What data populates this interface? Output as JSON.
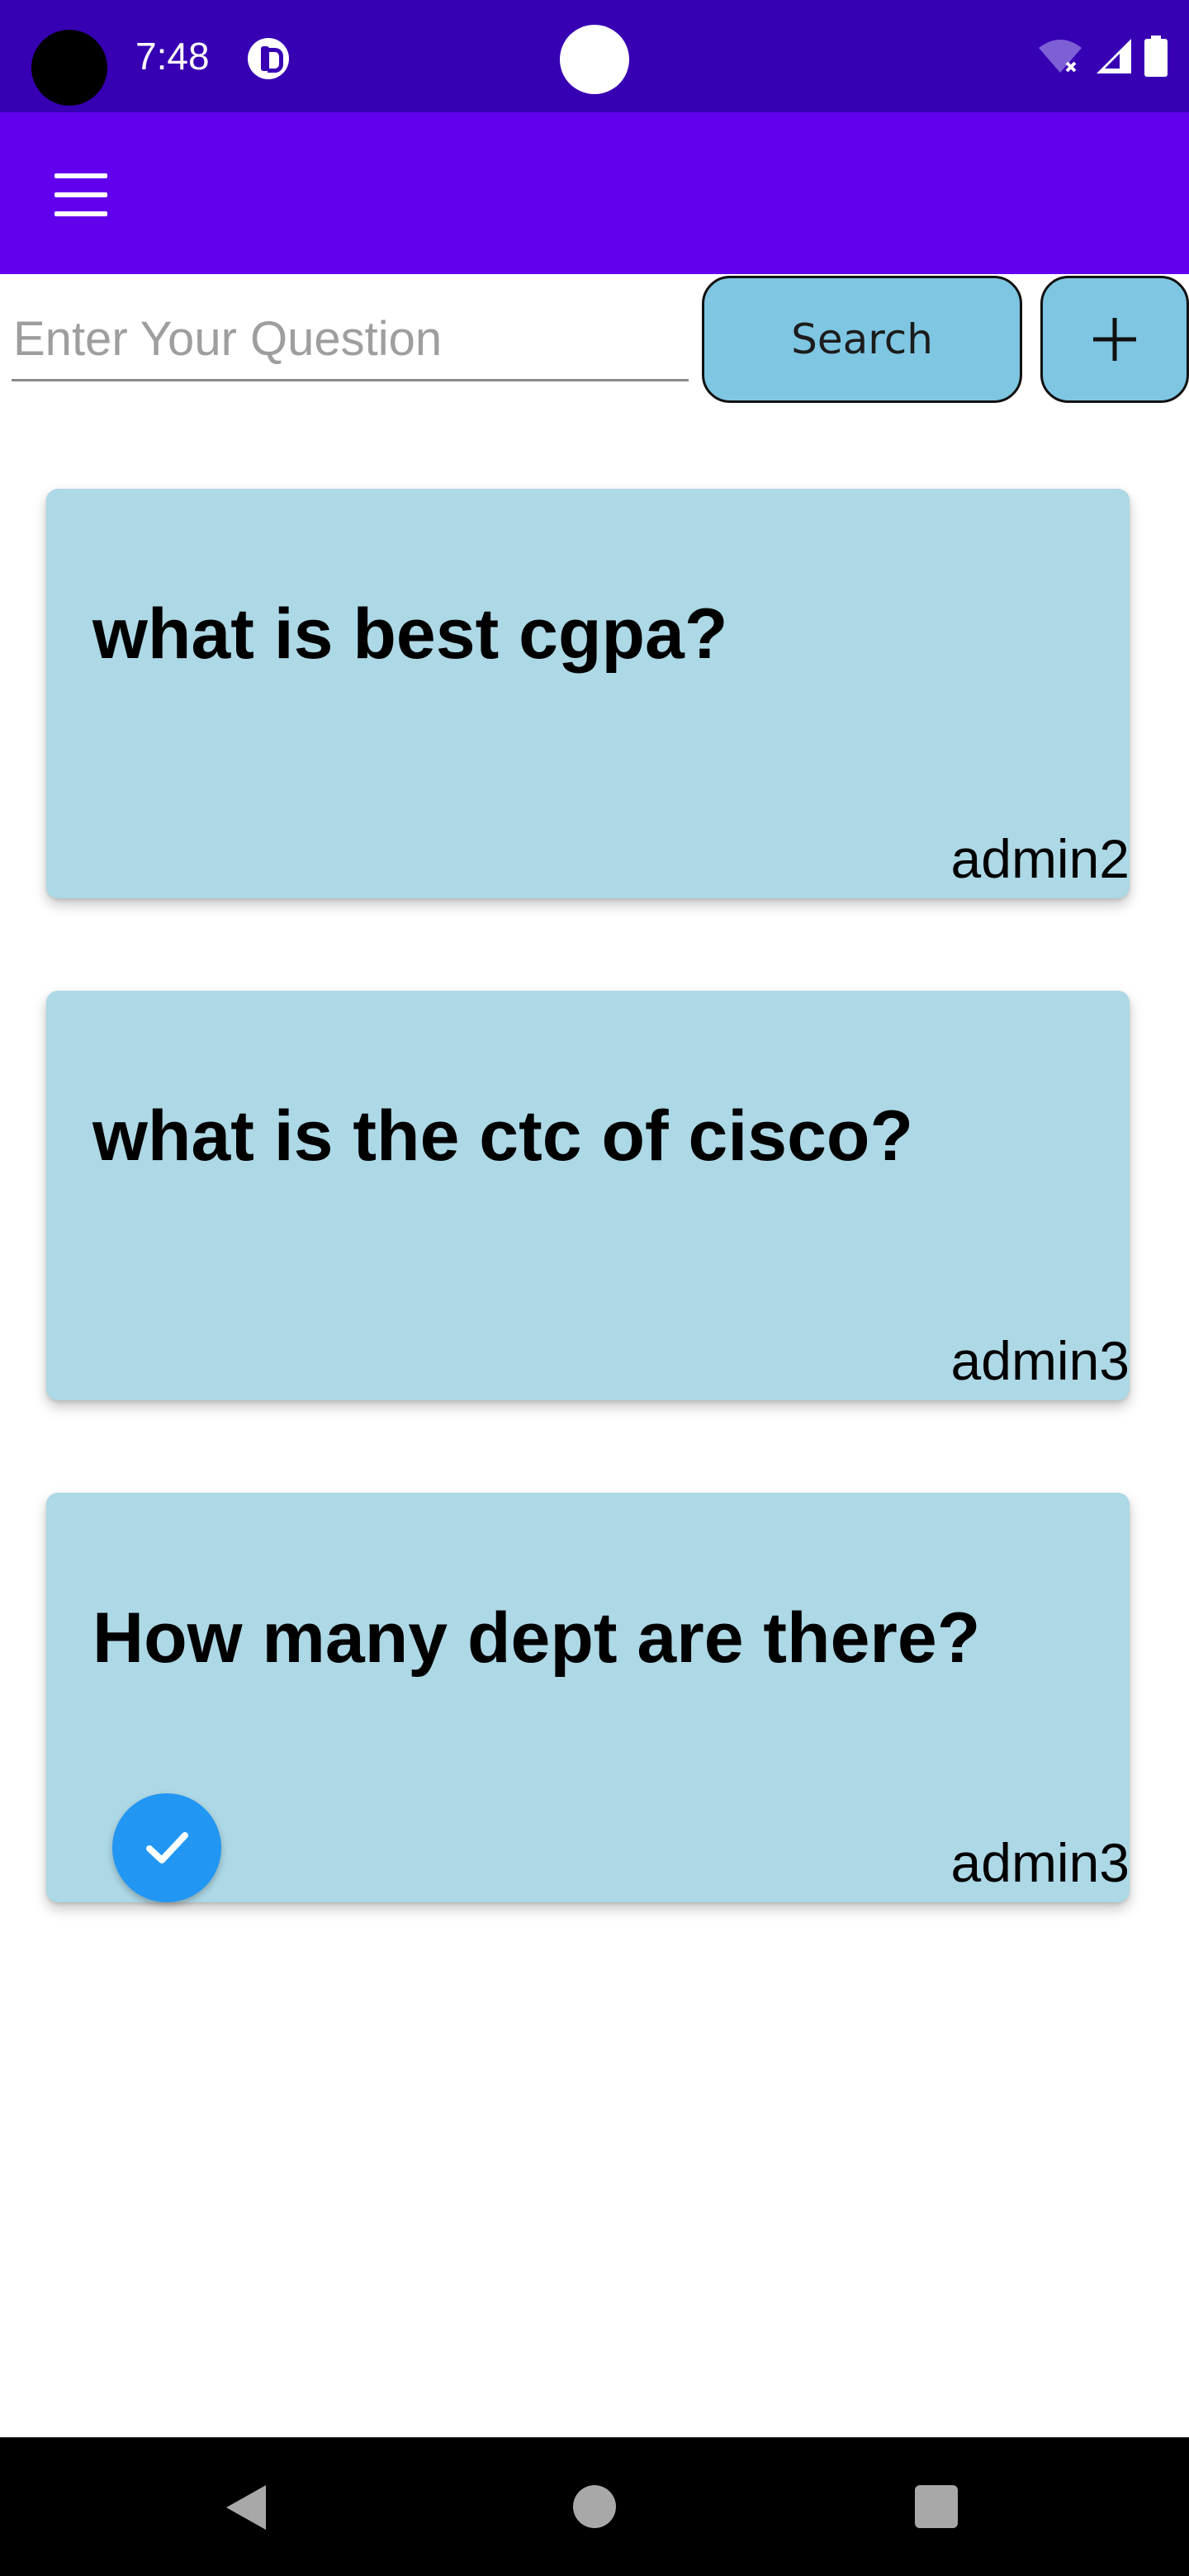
{
  "status_bar": {
    "time": "7:48",
    "icons": [
      "app-notification-icon",
      "wifi-off-icon",
      "signal-icon",
      "battery-icon"
    ]
  },
  "app_bar": {
    "menu_icon": "hamburger-menu-icon",
    "background_color": "#6200EE"
  },
  "search": {
    "placeholder": "Enter Your Question",
    "value": "",
    "button_label": "Search",
    "add_icon": "plus-icon"
  },
  "questions": [
    {
      "text": "what is best cgpa?",
      "author": "admin2",
      "checked": false
    },
    {
      "text": "what is the ctc of cisco?",
      "author": "admin3",
      "checked": false
    },
    {
      "text": "How many dept are there?",
      "author": "admin3",
      "checked": true
    }
  ],
  "colors": {
    "status_bar": "#3700B3",
    "app_bar": "#6200EE",
    "card": "#ADD8E6",
    "button": "#7EC6E2",
    "check_badge": "#2196F3"
  },
  "nav_bar": {
    "icons": [
      "back-icon",
      "home-icon",
      "recents-icon"
    ]
  }
}
